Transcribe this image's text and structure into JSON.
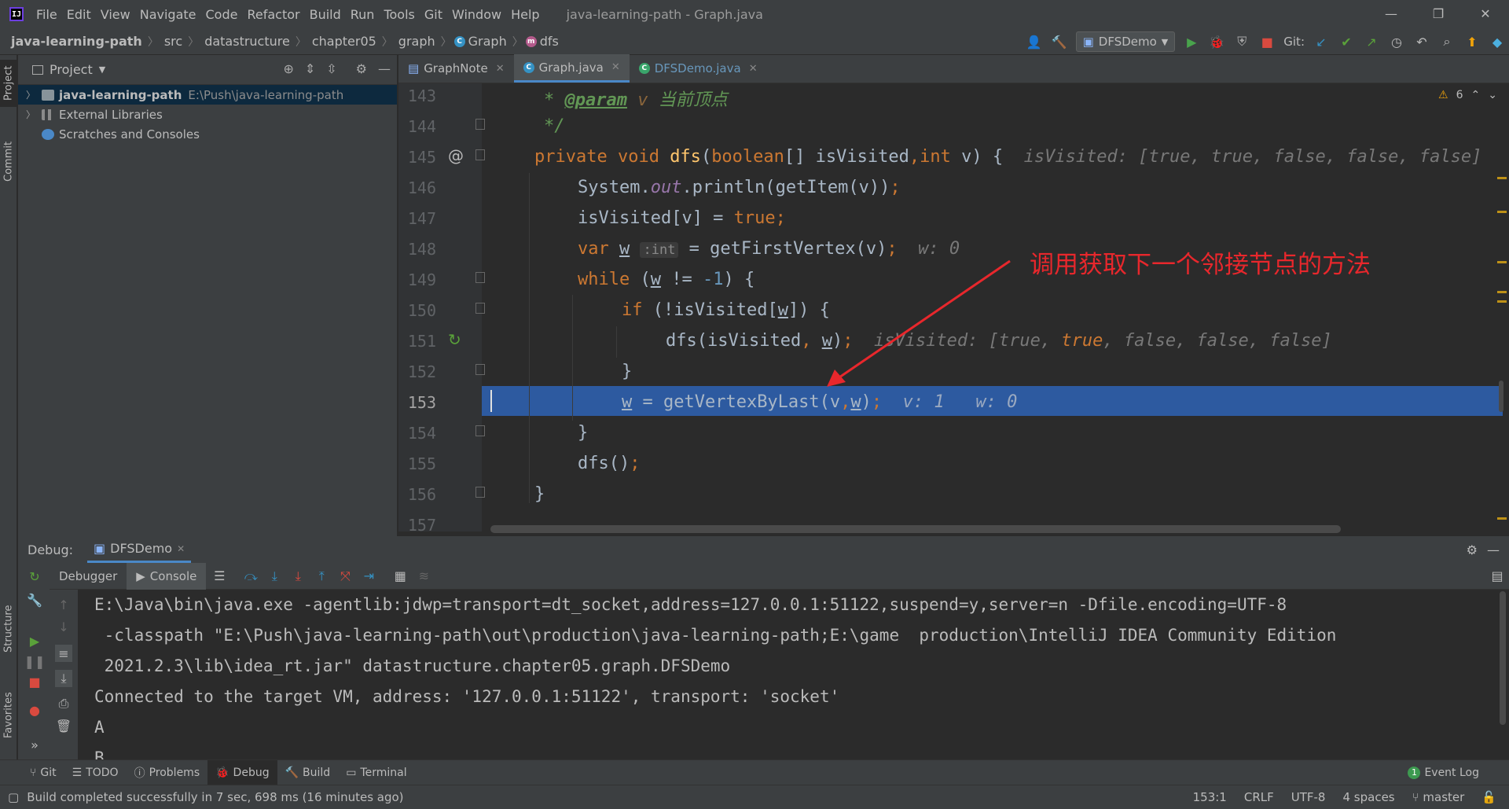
{
  "menubar": {
    "items": [
      "File",
      "Edit",
      "View",
      "Navigate",
      "Code",
      "Refactor",
      "Build",
      "Run",
      "Tools",
      "Git",
      "Window",
      "Help"
    ],
    "title": "java-learning-path - Graph.java"
  },
  "navbar": {
    "breadcrumbs": [
      "java-learning-path",
      "src",
      "datastructure",
      "chapter05",
      "graph",
      "Graph",
      "dfs"
    ],
    "run_config": "DFSDemo",
    "git_label": "Git:"
  },
  "leftstrip": {
    "tabs": [
      "Project",
      "Commit",
      "Structure",
      "Favorites"
    ]
  },
  "project": {
    "title": "Project",
    "tree": [
      {
        "label": "java-learning-path",
        "path": "E:\\Push\\java-learning-path"
      },
      {
        "label": "External Libraries"
      },
      {
        "label": "Scratches and Consoles"
      }
    ]
  },
  "editor": {
    "tabs": [
      "GraphNote",
      "Graph.java",
      "DFSDemo.java"
    ],
    "warnings": "6",
    "line_numbers": [
      "143",
      "144",
      "145",
      "146",
      "147",
      "148",
      "149",
      "150",
      "151",
      "152",
      "153",
      "154",
      "155",
      "156",
      "157"
    ],
    "lines": {
      "l143_a": "* ",
      "l143_tag": "@param",
      "l143_b": " v ",
      "l143_c": "当前顶点",
      "l144": "*/",
      "l145_a": "private void ",
      "l145_fn": "dfs",
      "l145_b": "(",
      "l145_c": "boolean",
      "l145_d": "[] isVisited",
      "l145_e": ",",
      "l145_f": "int",
      "l145_g": " v) {",
      "l145_hint": "isVisited: [true, true, false, false, false]",
      "l146_a": "System.",
      "l146_b": "out",
      "l146_c": ".println(getItem(v))",
      "l146_d": ";",
      "l147_a": "isVisited[v] = ",
      "l147_b": "true",
      "l147_c": ";",
      "l148_a": "var ",
      "l148_b": "w",
      "l148_inlay": ":int",
      "l148_c": " = getFirstVertex(v)",
      "l148_d": ";",
      "l148_hint": "w: 0",
      "l149_a": "while",
      "l149_b": " (",
      "l149_c": "w",
      "l149_d": " != ",
      "l149_e": "-1",
      "l149_f": ") {",
      "l150_a": "if",
      "l150_b": " (!isVisited[",
      "l150_c": "w",
      "l150_d": "]) {",
      "l151_a": "dfs(isVisited",
      "l151_b": ",",
      "l151_c": " ",
      "l151_d": "w",
      "l151_e": ")",
      "l151_f": ";",
      "l151_h1": "isVisited: [true, ",
      "l151_h2": "true",
      "l151_h3": ", false, false, false]",
      "l152": "}",
      "l153_a": "w",
      "l153_b": " = getVertexByLast(v",
      "l153_c": ",",
      "l153_d": "w",
      "l153_e": ")",
      "l153_f": ";",
      "l153_hint": "v: 1   w: 0",
      "l154": "}",
      "l155_a": "dfs()",
      "l155_b": ";",
      "l156": "}"
    },
    "annotation": "调用获取下一个邻接节点的方法"
  },
  "debug": {
    "label": "Debug:",
    "session": "DFSDemo",
    "tabs": [
      "Debugger",
      "Console"
    ],
    "console": [
      "E:\\Java\\bin\\java.exe -agentlib:jdwp=transport=dt_socket,address=127.0.0.1:51122,suspend=y,server=n -Dfile.encoding=UTF-8",
      " -classpath \"E:\\Push\\java-learning-path\\out\\production\\java-learning-path;E:\\game  production\\IntelliJ IDEA Community Edition",
      " 2021.2.3\\lib\\idea_rt.jar\" datastructure.chapter05.graph.DFSDemo",
      "Connected to the target VM, address: '127.0.0.1:51122', transport: 'socket'",
      "A",
      "B"
    ]
  },
  "bottombar": {
    "tools": [
      "Git",
      "TODO",
      "Problems",
      "Debug",
      "Build",
      "Terminal"
    ],
    "event_log": "Event Log",
    "event_count": "1"
  },
  "status": {
    "message": "Build completed successfully in 7 sec, 698 ms (16 minutes ago)",
    "position": "153:1",
    "line_sep": "CRLF",
    "encoding": "UTF-8",
    "indent": "4 spaces",
    "branch": "master"
  },
  "colors": {
    "accent": "#2d5aa0",
    "annotation": "#e8272c",
    "keyword": "#cc7832",
    "function": "#ffc66d"
  }
}
